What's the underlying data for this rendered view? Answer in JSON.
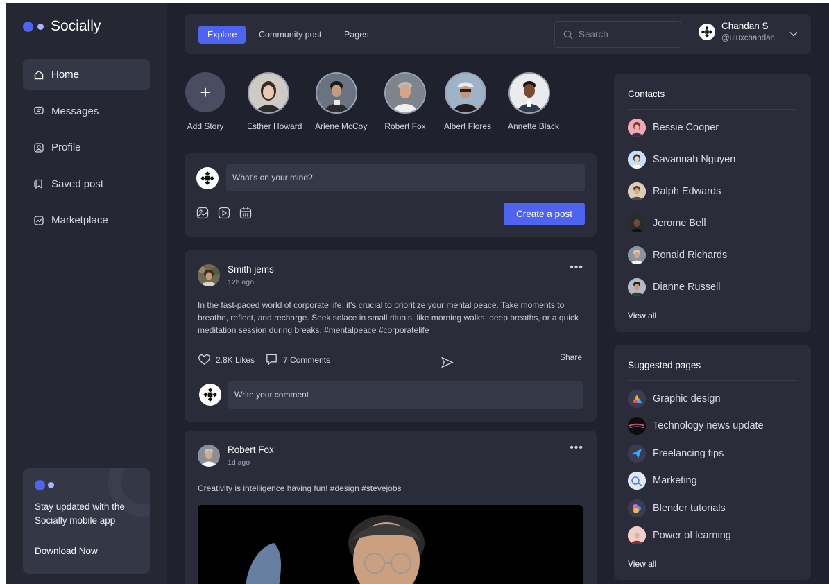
{
  "brand": {
    "name": "Socially"
  },
  "sidebar": {
    "items": [
      {
        "label": "Home",
        "icon": "home-icon",
        "active": true
      },
      {
        "label": "Messages",
        "icon": "message-icon",
        "active": false
      },
      {
        "label": "Profile",
        "icon": "profile-icon",
        "active": false
      },
      {
        "label": "Saved post",
        "icon": "bookmark-icon",
        "active": false
      },
      {
        "label": "Marketplace",
        "icon": "marketplace-icon",
        "active": false
      }
    ],
    "promo": {
      "text": "Stay updated with the Socially mobile app",
      "cta": "Download Now"
    }
  },
  "topbar": {
    "tabs": [
      {
        "label": "Explore",
        "active": true
      },
      {
        "label": "Community post",
        "active": false
      },
      {
        "label": "Pages",
        "active": false
      }
    ],
    "search_placeholder": "Search",
    "user": {
      "name": "Chandan S",
      "handle": "@uiuxchandan"
    }
  },
  "stories": [
    {
      "label": "Add Story",
      "add": true
    },
    {
      "label": "Esther Howard"
    },
    {
      "label": "Arlene McCoy"
    },
    {
      "label": "Robert Fox"
    },
    {
      "label": "Albert Flores"
    },
    {
      "label": "Annette Black"
    }
  ],
  "composer": {
    "placeholder": "What's on your mind?",
    "button": "Create a post"
  },
  "posts": [
    {
      "author": "Smith jems",
      "time": "12h ago",
      "text": "In the fast-paced world of corporate life, it's crucial to prioritize your mental peace. Take moments to breathe, reflect, and recharge. Seek solace in small rituals, like morning walks, deep breaths, or a quick meditation session during breaks. #mentalpeace #corporatelife",
      "likes": "2.8K Likes",
      "comments": "7 Comments",
      "share": "Share",
      "comment_placeholder": "Write your comment"
    },
    {
      "author": "Robert Fox",
      "time": "1d ago",
      "text": "Creativity is intelligence having fun! #design #stevejobs"
    }
  ],
  "contacts": {
    "title": "Contacts",
    "items": [
      "Bessie Cooper",
      "Savannah Nguyen",
      "Ralph Edwards",
      "Jerome Bell",
      "Ronald Richards",
      "Dianne Russell"
    ],
    "view_all": "View all"
  },
  "suggested": {
    "title": "Suggested pages",
    "items": [
      "Graphic design",
      "Technology news update",
      "Freelancing tips",
      "Marketing",
      "Blender tutorials",
      "Power of learning"
    ],
    "view_all": "View all"
  },
  "colors": {
    "accent": "#4e63f0",
    "background": "#1f212c",
    "card": "#2a2c39",
    "sidebar": "#252733"
  }
}
